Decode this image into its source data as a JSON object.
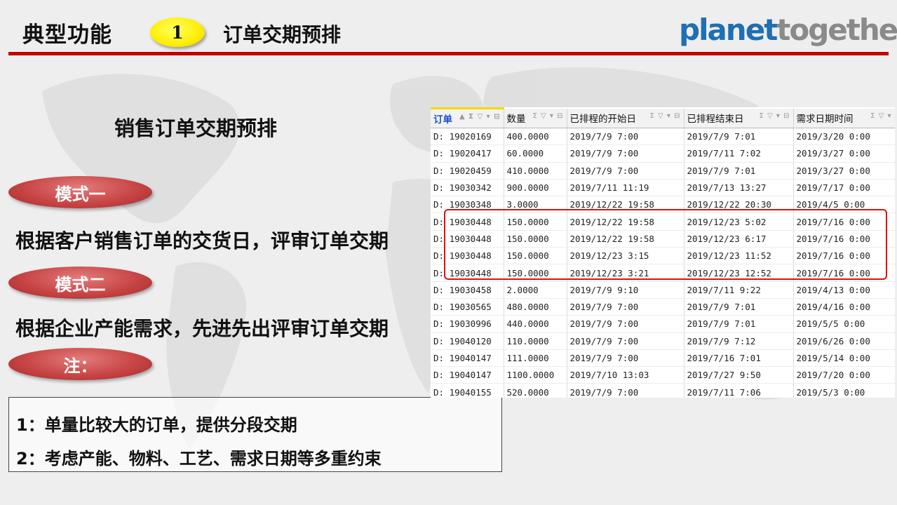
{
  "header": {
    "title": "典型功能",
    "badge_number": "1",
    "subtitle": "订单交期预排",
    "logo_part1": "planet",
    "logo_part2": "together",
    "accent_color": "#c00000",
    "badge_color": "#ffee00"
  },
  "main": {
    "heading": "销售订单交期预排",
    "mode1_label": "模式一",
    "mode1_desc": "根据客户销售订单的交货日，评审订单交期",
    "mode2_label": "模式二",
    "mode2_desc": "根据企业产能需求，先进先出评审订单交期",
    "note_label": "注：",
    "pill_color": "#c84545"
  },
  "notes": [
    "1：单量比较大的订单，提供分段交期",
    "2：考虑产能、物料、工艺、需求日期等多重约束"
  ],
  "grid": {
    "columns": [
      "订单",
      "数量",
      "已排程的开始日",
      "已排程结束日",
      "需求日期时间"
    ],
    "column_controls": [
      "▲ Σ ▽ ▾ ⊟",
      "Σ ▽ ▾ ⊟",
      "Σ ▽ ▾ ⊟",
      "Σ ▽ ▾ ⊟",
      "Σ ▽ ▾"
    ],
    "rows": [
      [
        "D: 19020169",
        "400.0000",
        "2019/7/9 7:00",
        "2019/7/9 7:01",
        "2019/3/20 0:00"
      ],
      [
        "D: 19020417",
        "60.0000",
        "2019/7/9 7:00",
        "2019/7/11 7:02",
        "2019/3/27 0:00"
      ],
      [
        "D: 19020459",
        "410.0000",
        "2019/7/9 7:00",
        "2019/7/9 7:01",
        "2019/3/27 0:00"
      ],
      [
        "D: 19030342",
        "900.0000",
        "2019/7/11 11:19",
        "2019/7/13 13:27",
        "2019/7/17 0:00"
      ],
      [
        "D: 19030348",
        "3.0000",
        "2019/12/22 19:58",
        "2019/12/22 20:30",
        "2019/4/5 0:00"
      ],
      [
        "D: 19030448",
        "150.0000",
        "2019/12/22 19:58",
        "2019/12/23 5:02",
        "2019/7/16 0:00"
      ],
      [
        "D: 19030448",
        "150.0000",
        "2019/12/22 19:58",
        "2019/12/23 6:17",
        "2019/7/16 0:00"
      ],
      [
        "D: 19030448",
        "150.0000",
        "2019/12/23 3:15",
        "2019/12/23 11:52",
        "2019/7/16 0:00"
      ],
      [
        "D: 19030448",
        "150.0000",
        "2019/12/23 3:21",
        "2019/12/23 12:52",
        "2019/7/16 0:00"
      ],
      [
        "D: 19030458",
        "2.0000",
        "2019/7/9 9:10",
        "2019/7/11 9:22",
        "2019/4/13 0:00"
      ],
      [
        "D: 19030565",
        "480.0000",
        "2019/7/9 7:00",
        "2019/7/9 7:01",
        "2019/4/16 0:00"
      ],
      [
        "D: 19030996",
        "440.0000",
        "2019/7/9 7:00",
        "2019/7/9 7:01",
        "2019/5/5 0:00"
      ],
      [
        "D: 19040120",
        "110.0000",
        "2019/7/9 7:00",
        "2019/7/9 7:12",
        "2019/6/26 0:00"
      ],
      [
        "D: 19040147",
        "111.0000",
        "2019/7/9 7:00",
        "2019/7/16 7:01",
        "2019/5/14 0:00"
      ],
      [
        "D: 19040147",
        "1100.0000",
        "2019/7/10 13:03",
        "2019/7/27 9:50",
        "2019/7/20 0:00"
      ],
      [
        "D: 19040155",
        "520.0000",
        "2019/7/9 7:00",
        "2019/7/11 7:06",
        "2019/5/3 0:00"
      ]
    ],
    "highlight_color": "#e01010"
  }
}
